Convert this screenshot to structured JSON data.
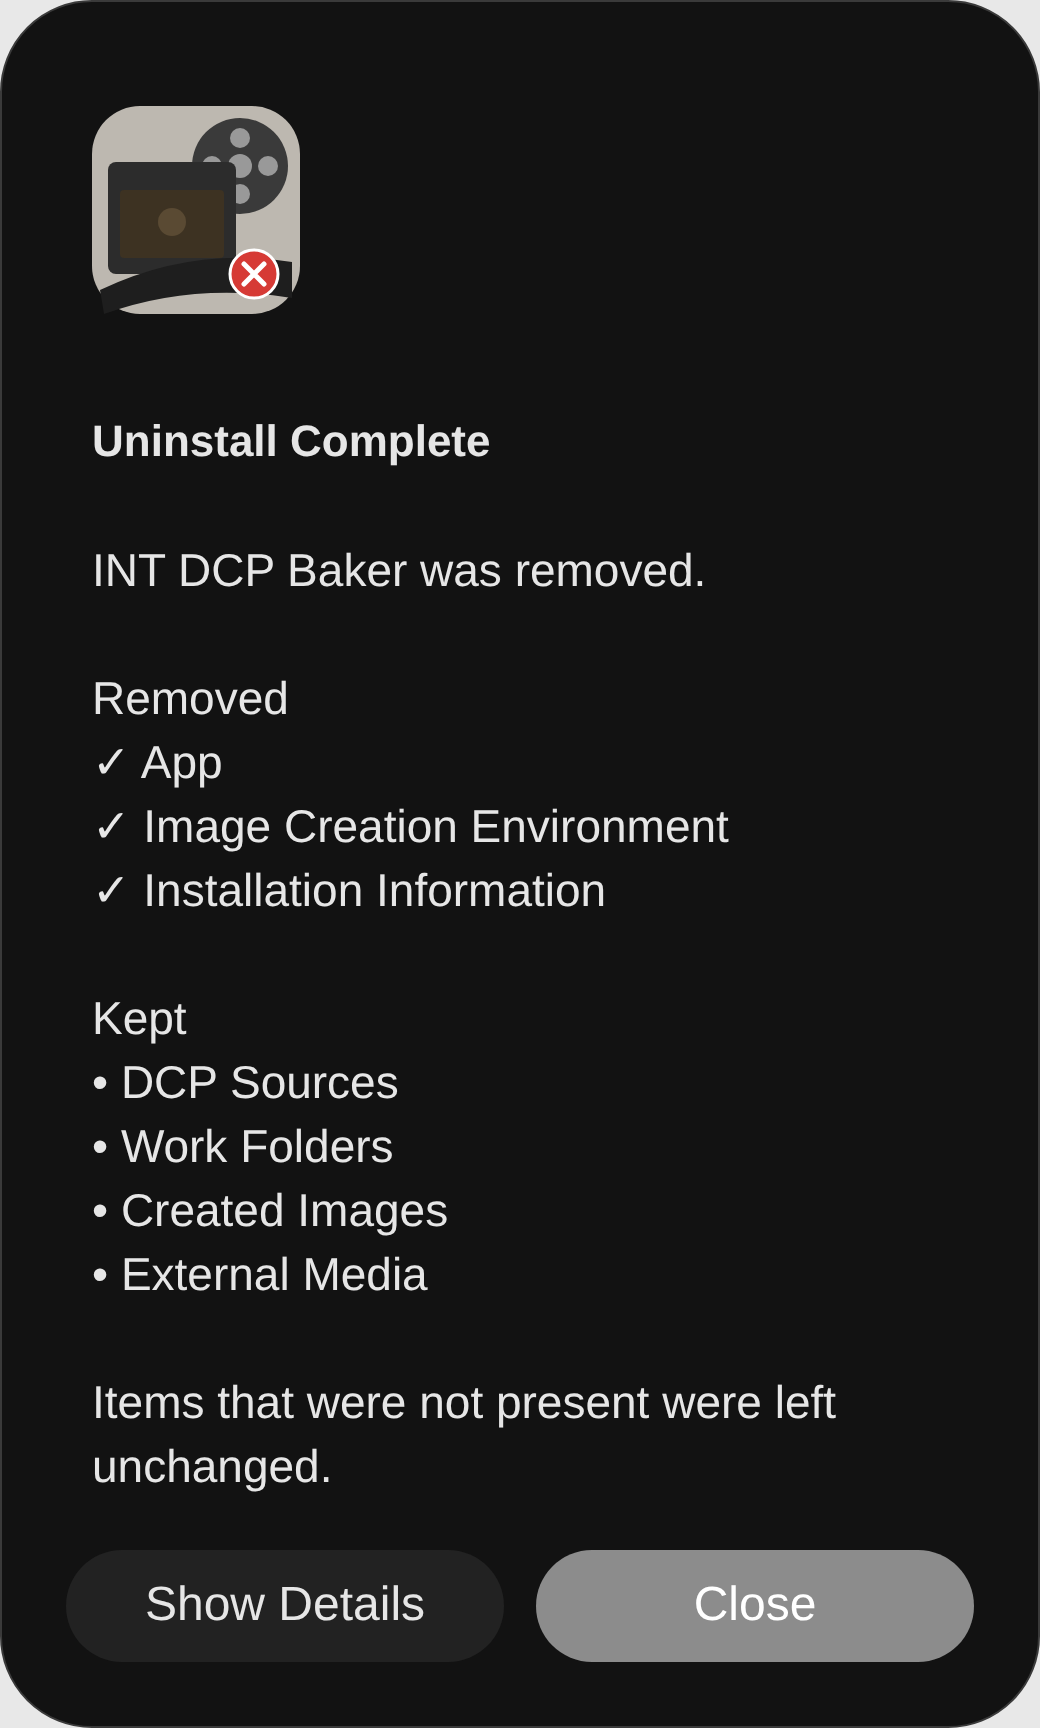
{
  "dialog": {
    "title": "Uninstall Complete",
    "message": "INT DCP Baker was removed.",
    "sections": [
      {
        "heading": "Removed",
        "items": [
          "✓ App",
          "✓ Image Creation Environment",
          "✓ Installation Information"
        ]
      },
      {
        "heading": "Kept",
        "items": [
          "• DCP Sources",
          "• Work Folders",
          "• Created Images",
          "• External Media"
        ]
      }
    ],
    "note": "Items that were not present were left unchanged.",
    "buttons": [
      {
        "label": "Show Details",
        "kind": "secondary"
      },
      {
        "label": "Close",
        "kind": "primary"
      }
    ]
  }
}
